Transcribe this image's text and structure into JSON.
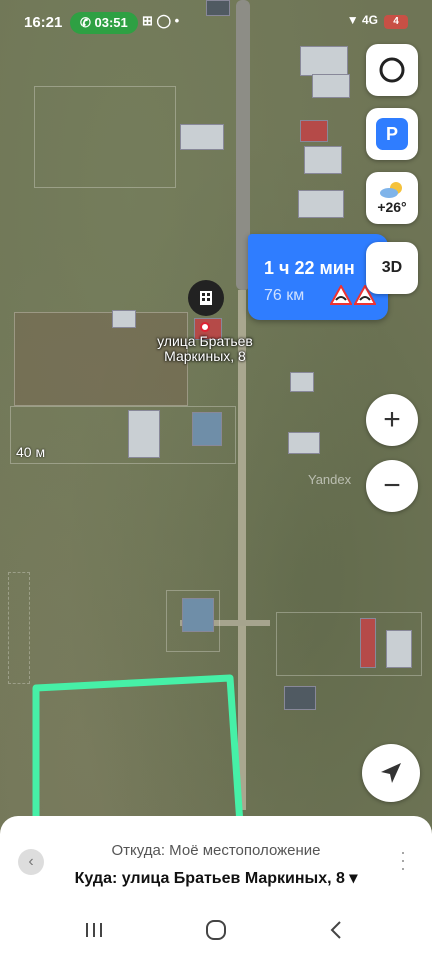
{
  "status_bar": {
    "time": "16:21",
    "call_timer": "03:51",
    "notification_icons": "⊞ ◯ •",
    "right_icons": "▼ 4G",
    "battery": "4"
  },
  "map": {
    "route": {
      "duration": "1 ч 22 мин",
      "distance": "76 км"
    },
    "address_label_line1": "улица Братьев",
    "address_label_line2": "Маркиных, 8",
    "scale_label": "40 м",
    "watermark": "Yandex",
    "weather_temp": "+26°",
    "view_3d_label": "3D",
    "parking_label": "P",
    "zoom_in_label": "+",
    "zoom_out_label": "−"
  },
  "bottom_sheet": {
    "from_text": "Откуда: Моё местоположение",
    "to_text": "Куда: улица Братьев Маркиных, 8 ▾"
  },
  "colors": {
    "route_blue": "#2f7dff",
    "highlight_green": "#46f0a7",
    "call_green": "#2ea043"
  }
}
